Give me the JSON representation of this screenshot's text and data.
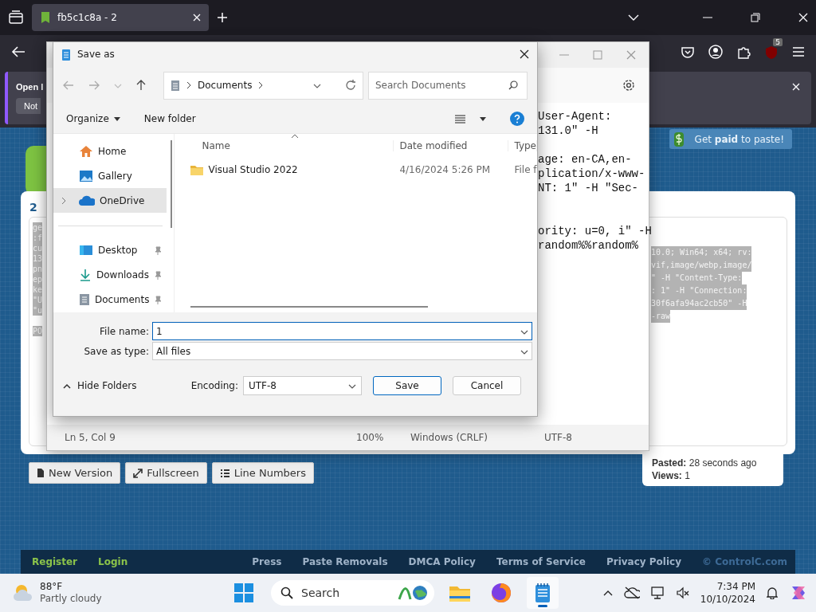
{
  "browser": {
    "tab": {
      "title": "fb5c1c8a - 2",
      "selected": true
    },
    "notification": {
      "message": "Open I",
      "button": "Not"
    },
    "extension_badge": "5"
  },
  "page": {
    "promo": "Get **paid** to paste!",
    "paste_number": "2",
    "left_fragments": [
      [
        "ge",
        ":f",
        "cu",
        "13",
        "pn",
        "ep",
        "ke",
        "\"U",
        "\"u"
      ],
      [
        "PO"
      ]
    ],
    "right_fragments": [
      "10.0; Win64; x64; rv:",
      "vif,image/webp,image/",
      "\" -H \"Content-Type:",
      ": 1\" -H \"Connection:",
      "30f6afa94ac2cb50\" -H",
      "-raw"
    ],
    "buttons": [
      {
        "label": "New Version",
        "kind": "file"
      },
      {
        "label": "Fullscreen",
        "kind": "expand"
      },
      {
        "label": "Line Numbers",
        "kind": "list"
      }
    ],
    "stats": [
      {
        "label": "Pasted:",
        "value": "28 seconds ago"
      },
      {
        "label": "Views:",
        "value": "1"
      }
    ],
    "footer": {
      "left_links": [
        "Register",
        "Login"
      ],
      "right_links": [
        "Press",
        "Paste Removals",
        "DMCA Policy",
        "Terms of Service",
        "Privacy Policy"
      ],
      "copyright": "© ControlC.com"
    }
  },
  "notepad": {
    "lines": [
      [
        "User-Agent:",
        "131.0\" -H"
      ],
      [
        "age: en-CA,en-",
        "plication/x-www-",
        "NT: 1\" -H \"Sec-"
      ],
      [
        "ority: u=0, i\" -H",
        "random%%random%"
      ]
    ],
    "status": [
      "Ln 5, Col 9",
      "100%",
      "Windows (CRLF)",
      "UTF-8"
    ]
  },
  "dialog": {
    "title": "Save as",
    "path": "Documents",
    "search_placeholder": "Search Documents",
    "organize": "Organize",
    "new_folder": "New folder",
    "nav_items": [
      {
        "label": "Home",
        "kind": "home",
        "selected": false,
        "pinned": false,
        "expandable": false
      },
      {
        "label": "Gallery",
        "kind": "gallery",
        "selected": false,
        "pinned": false,
        "expandable": false
      },
      {
        "label": "OneDrive",
        "kind": "cloud",
        "selected": true,
        "pinned": false,
        "expandable": true
      },
      {
        "label": "Desktop",
        "kind": "desktop",
        "selected": false,
        "pinned": true,
        "expandable": false
      },
      {
        "label": "Downloads",
        "kind": "download",
        "selected": false,
        "pinned": true,
        "expandable": false
      },
      {
        "label": "Documents",
        "kind": "document",
        "selected": false,
        "pinned": true,
        "expandable": false
      }
    ],
    "columns": [
      "Name",
      "Date modified",
      "Type"
    ],
    "files": [
      {
        "name": "Visual Studio 2022",
        "date": "4/16/2024 5:26 PM",
        "type": "File f",
        "selected": false
      }
    ],
    "file_name_label": "File name:",
    "file_name": "1",
    "type_label": "Save as type:",
    "type_value": "All files",
    "hide_folders": "Hide Folders",
    "encoding_label": "Encoding:",
    "encoding": "UTF-8",
    "save": "Save",
    "cancel": "Cancel"
  },
  "taskbar": {
    "temperature": "88°F",
    "condition": "Partly cloudy",
    "search": "Search",
    "apps": [
      {
        "kind": "folder",
        "active": false
      },
      {
        "kind": "browser",
        "active": false
      },
      {
        "kind": "notepad",
        "active": true
      }
    ],
    "time": "7:34 PM",
    "date": "10/10/2024"
  }
}
